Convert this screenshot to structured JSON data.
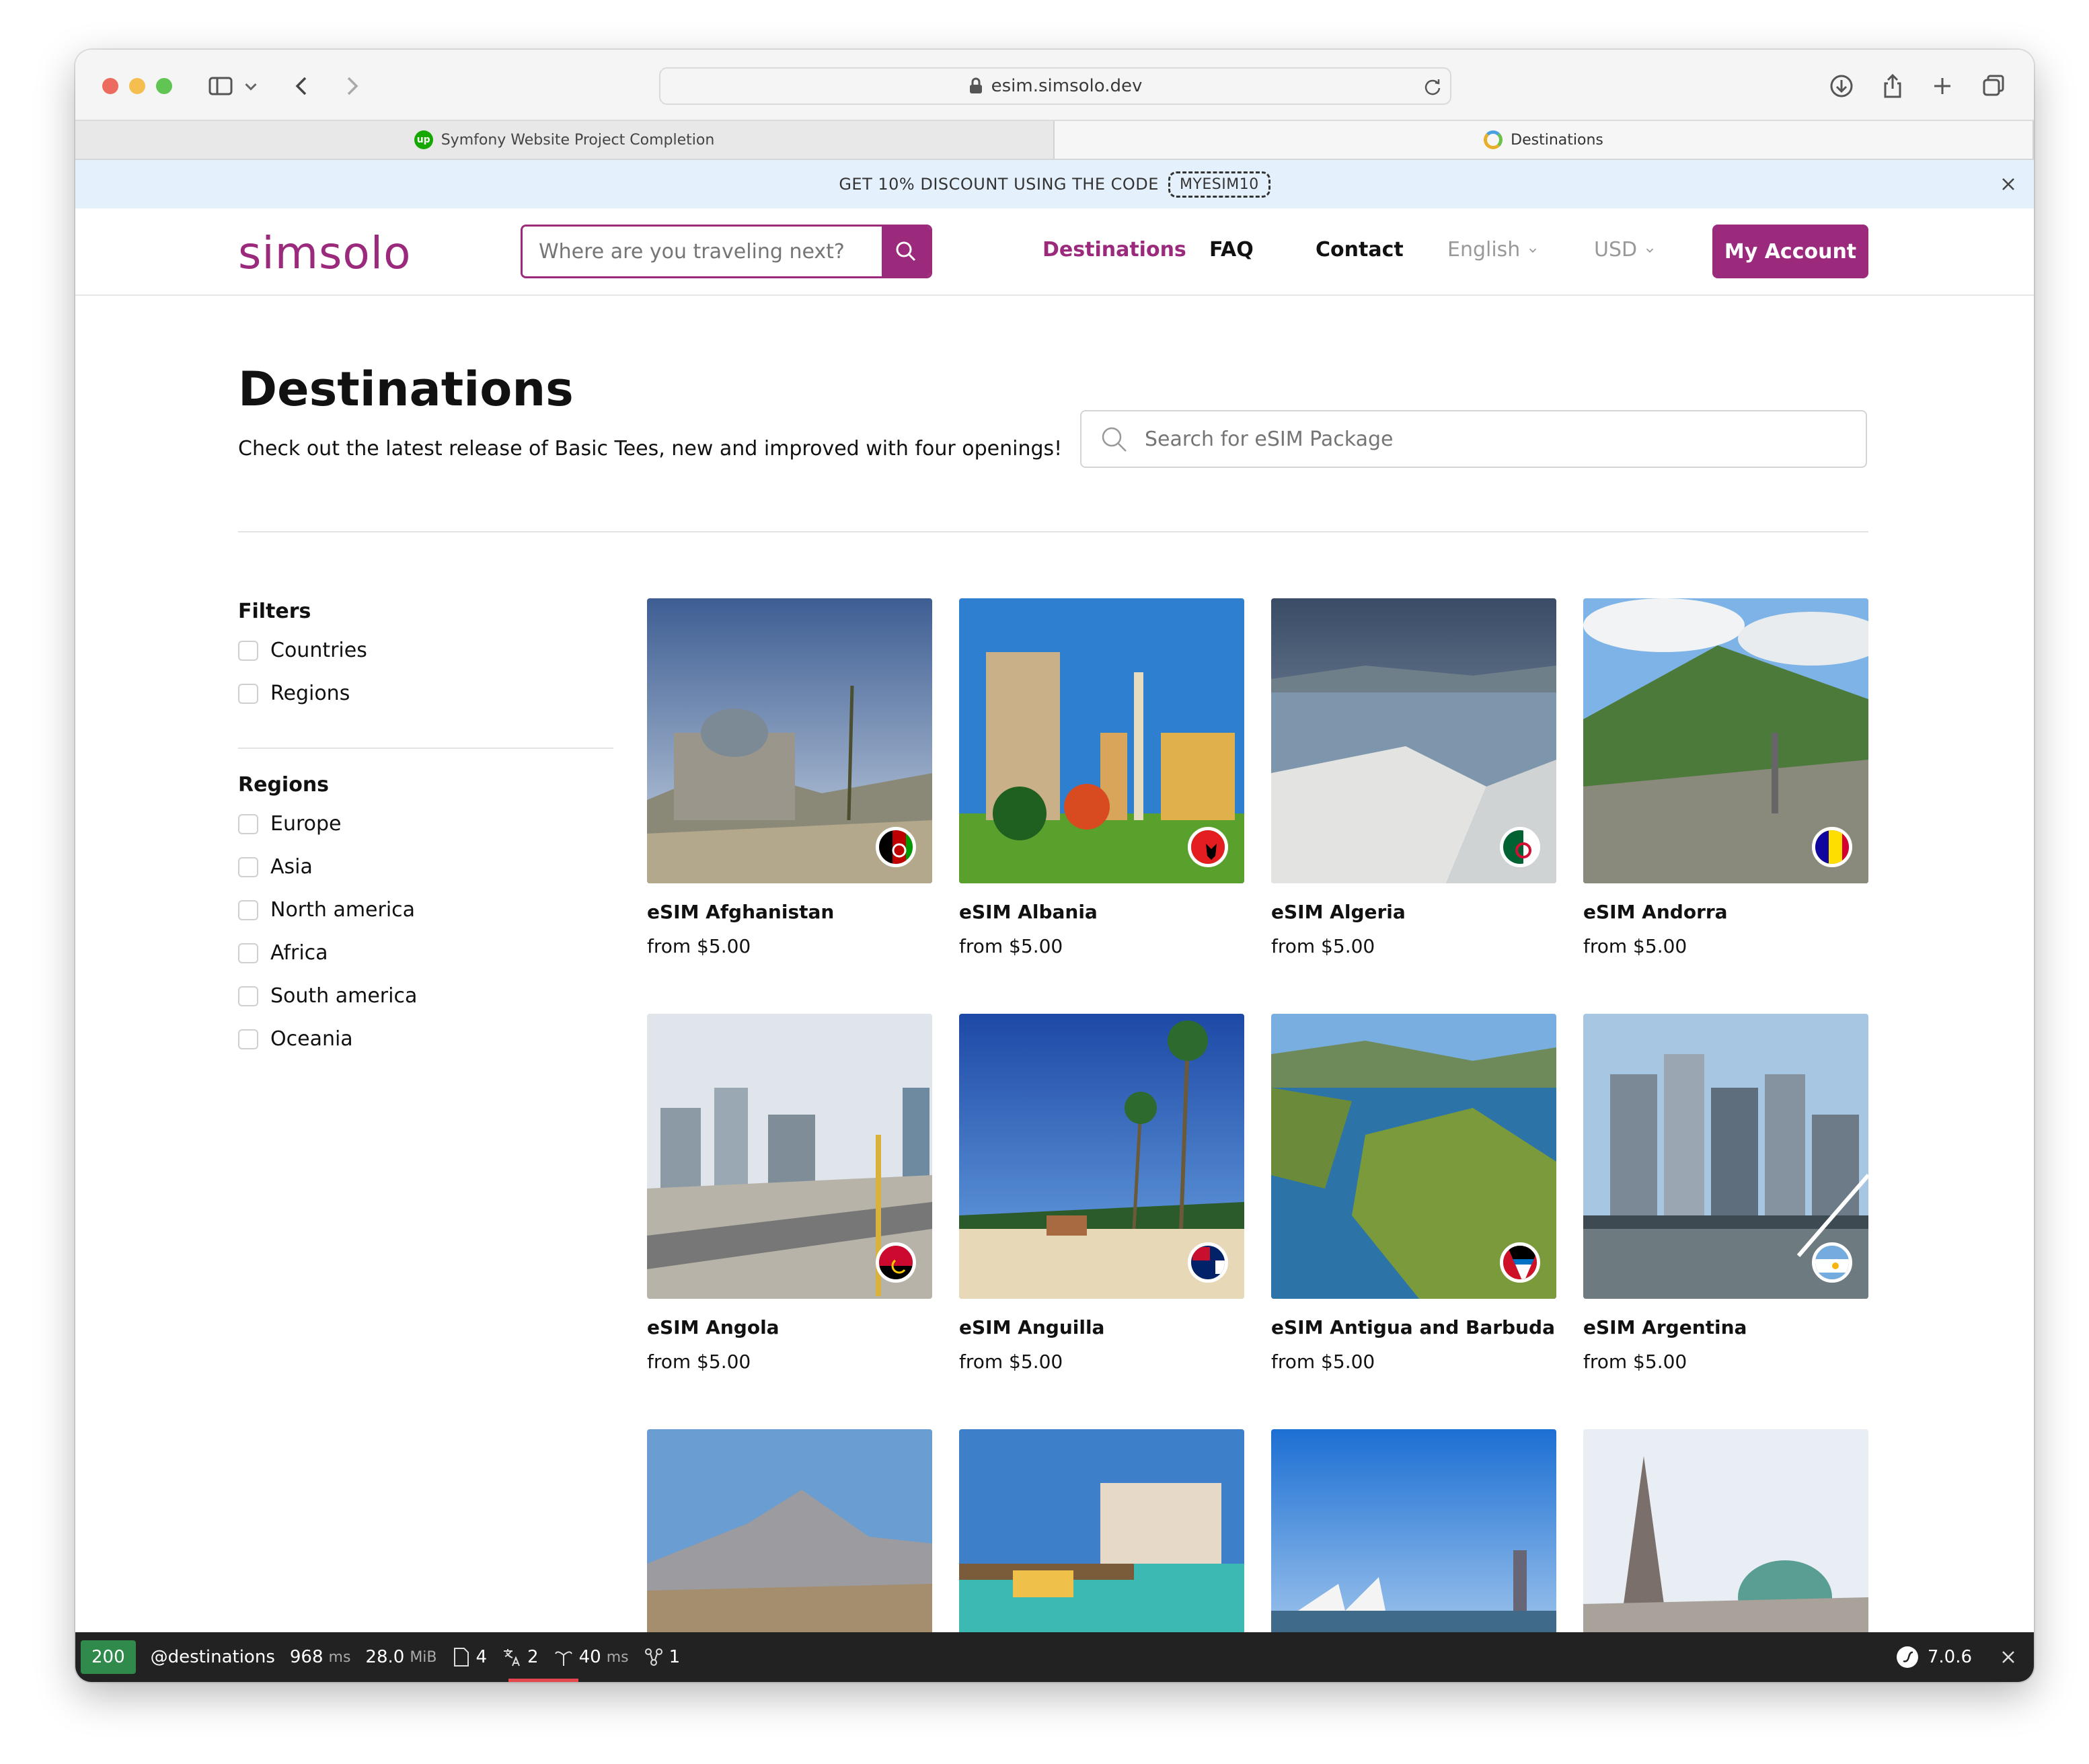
{
  "browser": {
    "url": "esim.simsolo.dev",
    "tabs": [
      {
        "label": "Symfony Website Project Completion",
        "icon": "upwork-icon",
        "active": true
      },
      {
        "label": "Destinations",
        "icon": "simsolo-favicon",
        "active": false
      }
    ]
  },
  "promo": {
    "text": "GET 10% DISCOUNT USING THE CODE",
    "code": "MYESIM10"
  },
  "header": {
    "logo": "simsolo",
    "search_placeholder": "Where are you traveling next?",
    "nav": {
      "destinations": "Destinations",
      "faq": "FAQ",
      "contact": "Contact",
      "language": "English",
      "currency": "USD"
    },
    "account_label": "My Account",
    "brand_color": "#9b2a7c"
  },
  "page": {
    "title": "Destinations",
    "subtitle": "Check out the latest release of Basic Tees, new and improved with four openings!",
    "search_placeholder": "Search for eSIM Package"
  },
  "filters": {
    "heading": "Filters",
    "options": [
      "Countries",
      "Regions"
    ],
    "regions_heading": "Regions",
    "regions": [
      "Europe",
      "Asia",
      "North america",
      "Africa",
      "South america",
      "Oceania"
    ]
  },
  "cards": [
    {
      "name": "eSIM Afghanistan",
      "price": "from $5.00"
    },
    {
      "name": "eSIM Albania",
      "price": "from $5.00"
    },
    {
      "name": "eSIM Algeria",
      "price": "from $5.00"
    },
    {
      "name": "eSIM Andorra",
      "price": "from $5.00"
    },
    {
      "name": "eSIM Angola",
      "price": "from $5.00"
    },
    {
      "name": "eSIM Anguilla",
      "price": "from $5.00"
    },
    {
      "name": "eSIM Antigua and Barbuda",
      "price": "from $5.00"
    },
    {
      "name": "eSIM Argentina",
      "price": "from $5.00"
    }
  ],
  "debug_toolbar": {
    "status": "200",
    "route": "@destinations",
    "time": "968",
    "time_unit": "ms",
    "memory": "28.0",
    "memory_unit": "MiB",
    "files": "4",
    "translations": "2",
    "twig_time": "40",
    "twig_unit": "ms",
    "events": "1",
    "version": "7.0.6"
  }
}
